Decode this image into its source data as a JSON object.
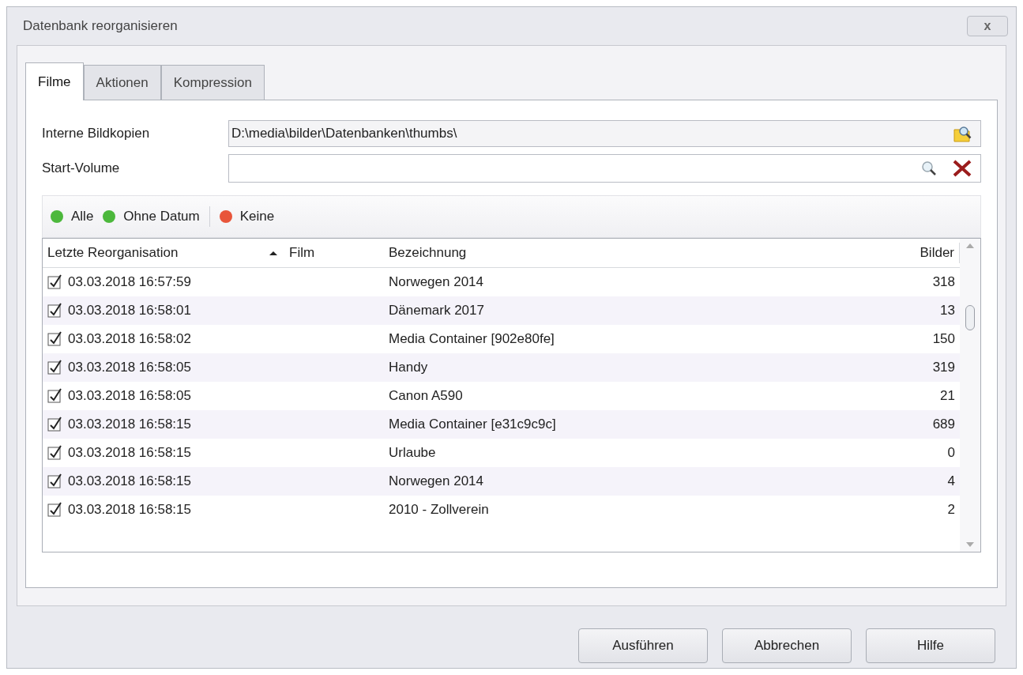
{
  "window": {
    "title": "Datenbank reorganisieren",
    "close": "x"
  },
  "tabs": [
    {
      "label": "Filme",
      "selected": true
    },
    {
      "label": "Aktionen",
      "selected": false
    },
    {
      "label": "Kompression",
      "selected": false
    }
  ],
  "fields": [
    {
      "label": "Interne Bildkopien",
      "value": "D:\\media\\bilder\\Datenbanken\\thumbs\\",
      "kind": "folder"
    },
    {
      "label": "Start-Volume",
      "kind": "search"
    }
  ],
  "filters": [
    {
      "label": "Alle",
      "color": "#4cb83c"
    },
    {
      "label": "Ohne Datum",
      "color": "#4cb83c"
    },
    {
      "label": "Keine",
      "color": "#e8553a"
    }
  ],
  "table": {
    "columns": [
      "Letzte Reorganisation",
      "Film",
      "Bezeichnung",
      "Bilder"
    ],
    "rows": [
      {
        "checked": true,
        "date": "03.03.2018 16:57:59",
        "name": "Norwegen 2014",
        "count": "318"
      },
      {
        "checked": true,
        "date": "03.03.2018 16:58:01",
        "name": "Dänemark 2017",
        "count": "13"
      },
      {
        "checked": true,
        "date": "03.03.2018 16:58:02",
        "name": "Media Container [902e80fe]",
        "count": "150"
      },
      {
        "checked": true,
        "date": "03.03.2018 16:58:05",
        "name": "Handy",
        "count": "319"
      },
      {
        "checked": true,
        "date": "03.03.2018 16:58:05",
        "name": "Canon A590",
        "count": "21"
      },
      {
        "checked": true,
        "date": "03.03.2018 16:58:15",
        "name": "Media Container [e31c9c9c]",
        "count": "689"
      },
      {
        "checked": true,
        "date": "03.03.2018 16:58:15",
        "name": "Urlaube",
        "count": "0"
      },
      {
        "checked": true,
        "date": "03.03.2018 16:58:15",
        "name": "Norwegen 2014",
        "count": "4"
      },
      {
        "checked": true,
        "date": "03.03.2018 16:58:15",
        "name": "2010 - Zollverein",
        "count": "2"
      }
    ]
  },
  "buttons": [
    "Ausführen",
    "Abbrechen",
    "Hilfe"
  ]
}
